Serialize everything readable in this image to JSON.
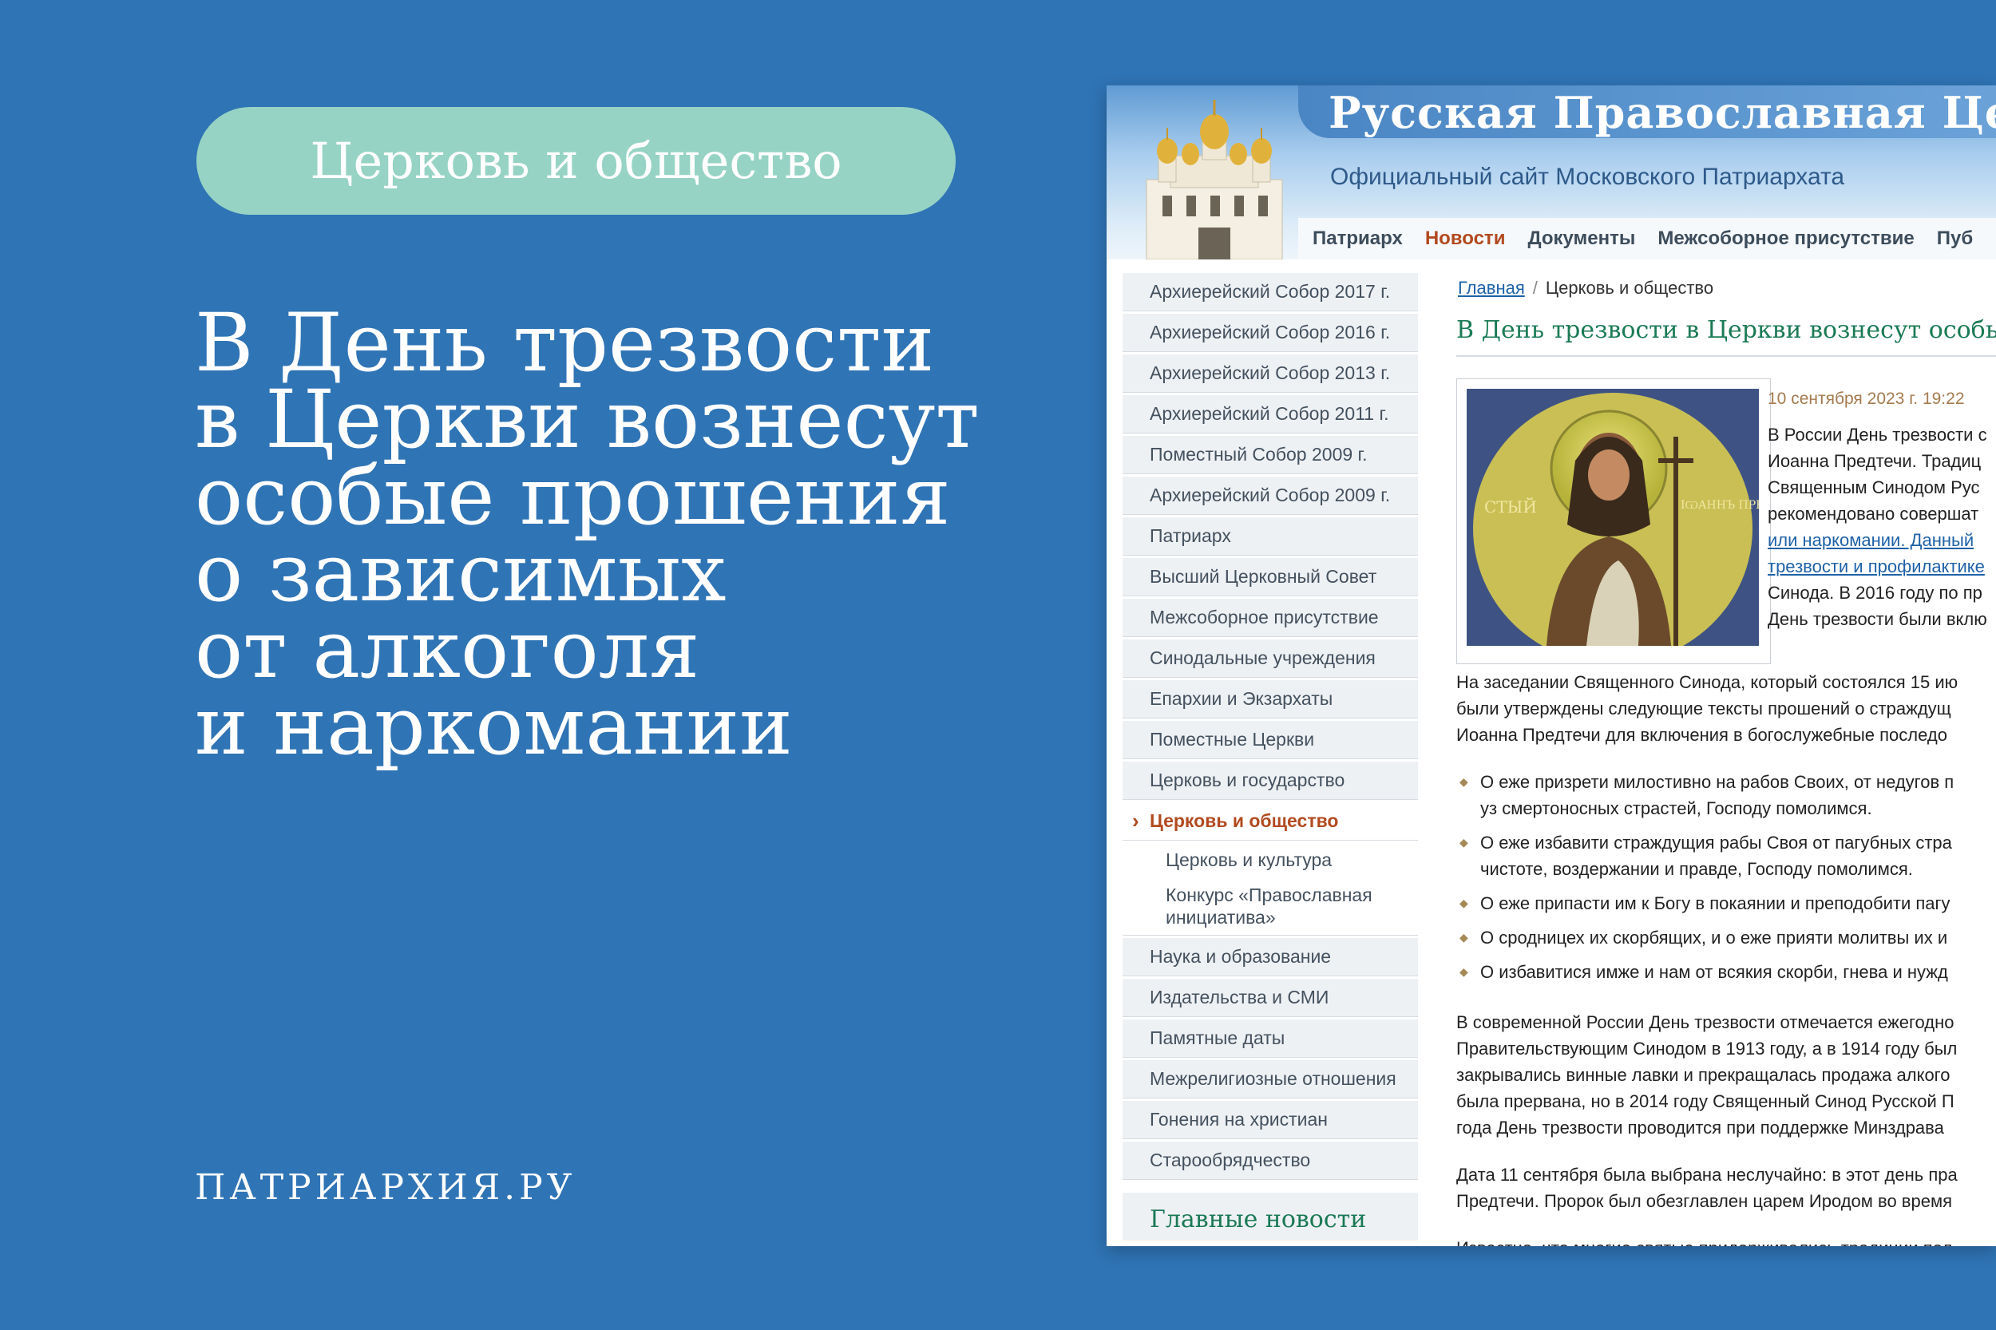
{
  "tag": "Церковь и общество",
  "headline": [
    "В День трезвости",
    "в Церкви вознесут",
    "особые прошения",
    "о зависимых",
    "от алкоголя",
    "и наркомании"
  ],
  "brand": "ПАТРИАРХИЯ.РУ",
  "site": {
    "title": "Русская Православная Церко",
    "subtitle": "Официальный сайт Московского Патриархата",
    "nav": [
      "Патриарх",
      "Новости",
      "Документы",
      "Межсоборное присутствие",
      "Пуб"
    ],
    "nav_active": "Новости"
  },
  "sidebar": {
    "items": [
      "Архиерейский Собор 2017 г.",
      "Архиерейский Собор 2016 г.",
      "Архиерейский Собор 2013 г.",
      "Архиерейский Собор 2011 г.",
      "Поместный Собор 2009 г.",
      "Архиерейский Собор 2009 г.",
      "Патриарх",
      "Высший Церковный Совет",
      "Межсоборное присутствие",
      "Синодальные учреждения",
      "Епархии и Экзархаты",
      "Поместные Церкви",
      "Церковь и государство"
    ],
    "active": "Церковь и общество",
    "subitems": [
      "Церковь и культура",
      "Конкурс «Православная",
      "инициатива»"
    ],
    "items_after": [
      "Наука и образование",
      "Издательства и СМИ",
      "Памятные даты",
      "Межрелигиозные отношения",
      "Гонения на христиан",
      "Старообрядчество"
    ],
    "section_head": "Главные новости"
  },
  "article": {
    "crumb_home": "Главная",
    "crumb_current": "Церковь и общество",
    "title": "В День трезвости в Церкви вознесут особые",
    "date": "10 сентября 2023 г. 19:22",
    "icon_left": "СТЫЙ",
    "icon_right": "ІѠАННЪ ПРЕТЕЧА",
    "lead": [
      "В России День трезвости с",
      "Иоанна Предтечи. Традиц",
      "Священным Синодом Рус",
      "рекомендовано совершат",
      "или наркомании. Данный",
      "трезвости и профилактике",
      "Синода. В 2016 году по пр",
      "День трезвости были вклю"
    ],
    "para1": [
      "На заседании Священного Синода, который состоялся 15 ию",
      "были утверждены следующие тексты прошений о страждущ",
      "Иоанна Предтечи для включения в богослужебные последо"
    ],
    "bullets": [
      [
        "О еже призрети милостивно на рабов Своих, от недугов п",
        "уз смертоносных страстей, Господу помолимся."
      ],
      [
        "О еже избавити страждущия рабы Своя от пагубных стра",
        "чистоте, воздержании и правде, Господу помолимся."
      ],
      [
        "О еже припасти им к Богу в покаянии и преподобити пагу"
      ],
      [
        "О сродницех их скорбящих, и о еже прияти молитвы их и"
      ],
      [
        "О избавитися имже и нам от всякия скорби, гнева и нужд"
      ]
    ],
    "para2": [
      "В современной России День трезвости отмечается ежегодно",
      "Правительствующим Синодом в 1913 году, а в 1914 году был",
      "закрывались винные лавки и прекращалась продажа алкого",
      "была прервана, но в 2014 году Священный Синод Русской П",
      "года День трезвости проводится при поддержке Минздрава"
    ],
    "para3": [
      "Дата 11 сентября была выбрана неслучайно: в этот день пра",
      "Предтечи. Пророк был обезглавлен царем Иродом во время"
    ],
    "para4": [
      "Известно, что многие святые придерживались традиции пол"
    ]
  },
  "colors": {
    "background": "#2f74b5",
    "tag_bg": "#96d3c4",
    "accent_green": "#1a7a55",
    "accent_orange": "#b24a1f",
    "link_blue": "#1f62a8"
  }
}
